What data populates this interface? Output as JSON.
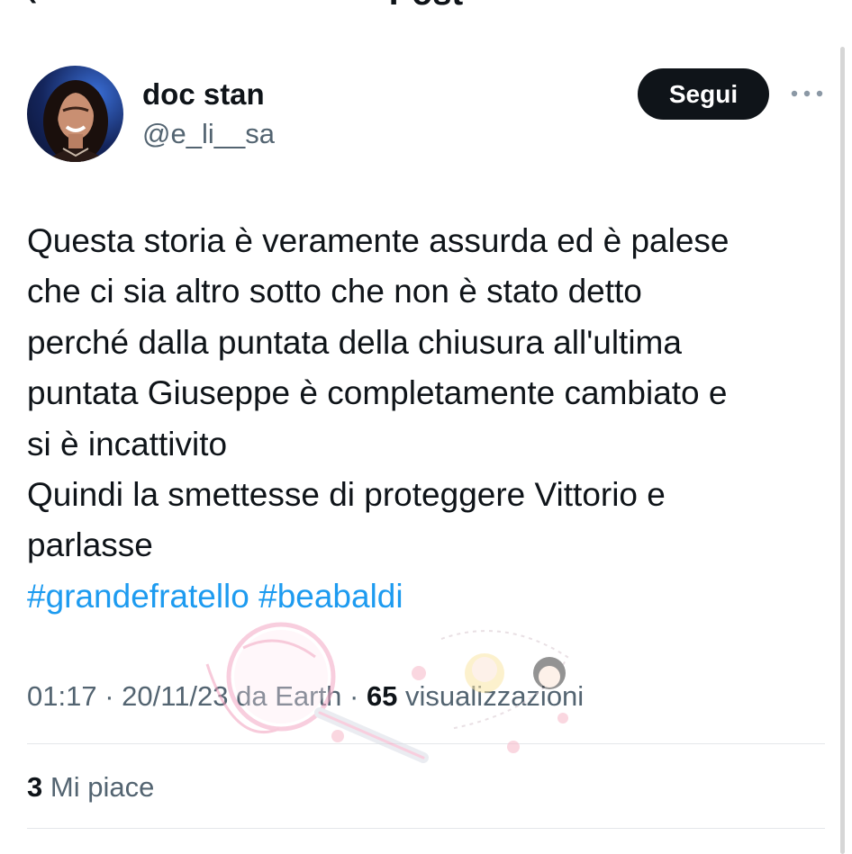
{
  "header": {
    "title": "Post",
    "back_icon": "arrow-left-icon"
  },
  "post": {
    "author": {
      "name": "doc stan",
      "handle": "@e_li__sa",
      "avatar_icon": "profile-photo"
    },
    "follow_label": "Segui",
    "more_icon": "ellipsis-icon",
    "text_lines": [
      "Questa storia è veramente assurda ed è palese",
      "che ci sia altro sotto che non è stato detto",
      "perché dalla puntata della chiusura all'ultima",
      "puntata Giuseppe è completamente cambiato e",
      "si è incattivito",
      "Quindi la smettesse di proteggere Vittorio e",
      "parlasse"
    ],
    "hashtags": [
      "#grandefratello",
      "#beabaldi"
    ],
    "meta": {
      "time": "01:17",
      "date": "20/11/23",
      "source": "da Earth",
      "separator": "·",
      "views_count": "65",
      "views_label": "visualizzazioni"
    },
    "likes": {
      "count": "3",
      "label": "Mi piace"
    }
  },
  "colors": {
    "text": "#0f1419",
    "secondary": "#536471",
    "link": "#1d9bf0",
    "button": "#0f1419",
    "divider": "#e4e7ea"
  }
}
